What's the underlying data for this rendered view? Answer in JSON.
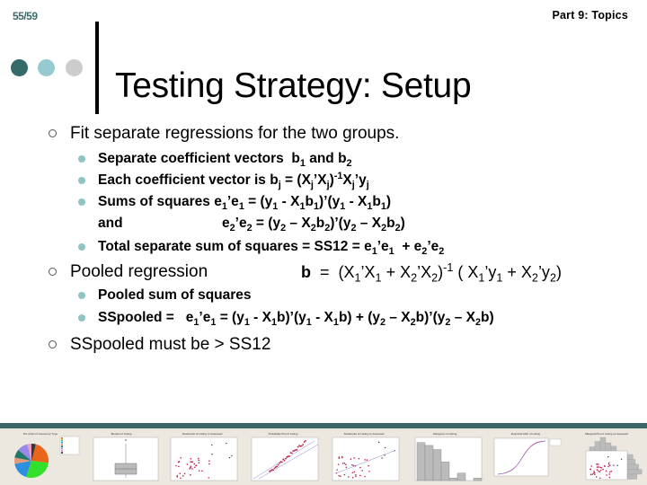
{
  "header": {
    "page_counter": "55/59",
    "section": "Part 9: Topics"
  },
  "colors": {
    "accent_dark": "#356a6b",
    "accent_light": "#95cbcf",
    "accent_gray": "#cccccc",
    "bar": "#3d6767",
    "sub_bullet": "#8fc4c4"
  },
  "title": "Testing Strategy: Setup",
  "content": {
    "bullet1": {
      "text": "Fit separate regressions for the two groups.",
      "subs": {
        "s1_text": "Separate coefficient vectors",
        "s1_b": "b",
        "s1_sub1": "1",
        "s1_and": "and",
        "s1_sub2": "2",
        "s2_text": "Each coefficient vector is",
        "s2_formula_b": "b",
        "s2_j": "j",
        "s2_eq": "= (X",
        "s2_prime_x": "’X",
        "s2_close": ")",
        "s2_neg1": "-1",
        "s2_x": "X",
        "s2_y": "’y",
        "s3_text": "Sums of squares",
        "s3_and": "and",
        "s4_text": "Total separate sum of squares = SS12 ="
      }
    },
    "bullet2": {
      "text": "Pooled regression",
      "subs": {
        "s1_text": "Pooled sum of squares",
        "s2_text": "SSpooled ="
      }
    },
    "bullet3": {
      "text": "SSpooled must be > SS12"
    }
  },
  "thumbnails": [
    {
      "name": "pie-chart",
      "title": "Pie Chart of Houses by Type"
    },
    {
      "name": "boxplot",
      "title": "Boxplot of Listing"
    },
    {
      "name": "scatterplot",
      "title": "Scatterplot of Listing vs Assessed"
    },
    {
      "name": "probability-plot",
      "title": "Probability Plot of Listing"
    },
    {
      "name": "fitted-scatterplot",
      "title": "Scatterplot of Listing vs Assessed"
    },
    {
      "name": "histogram",
      "title": "Histogram of Listing"
    },
    {
      "name": "empirical-cdf",
      "title": "Empirical CDF of Listing"
    },
    {
      "name": "marginal-plot",
      "title": "Marginal Plot of Listing vs Assessed"
    }
  ]
}
